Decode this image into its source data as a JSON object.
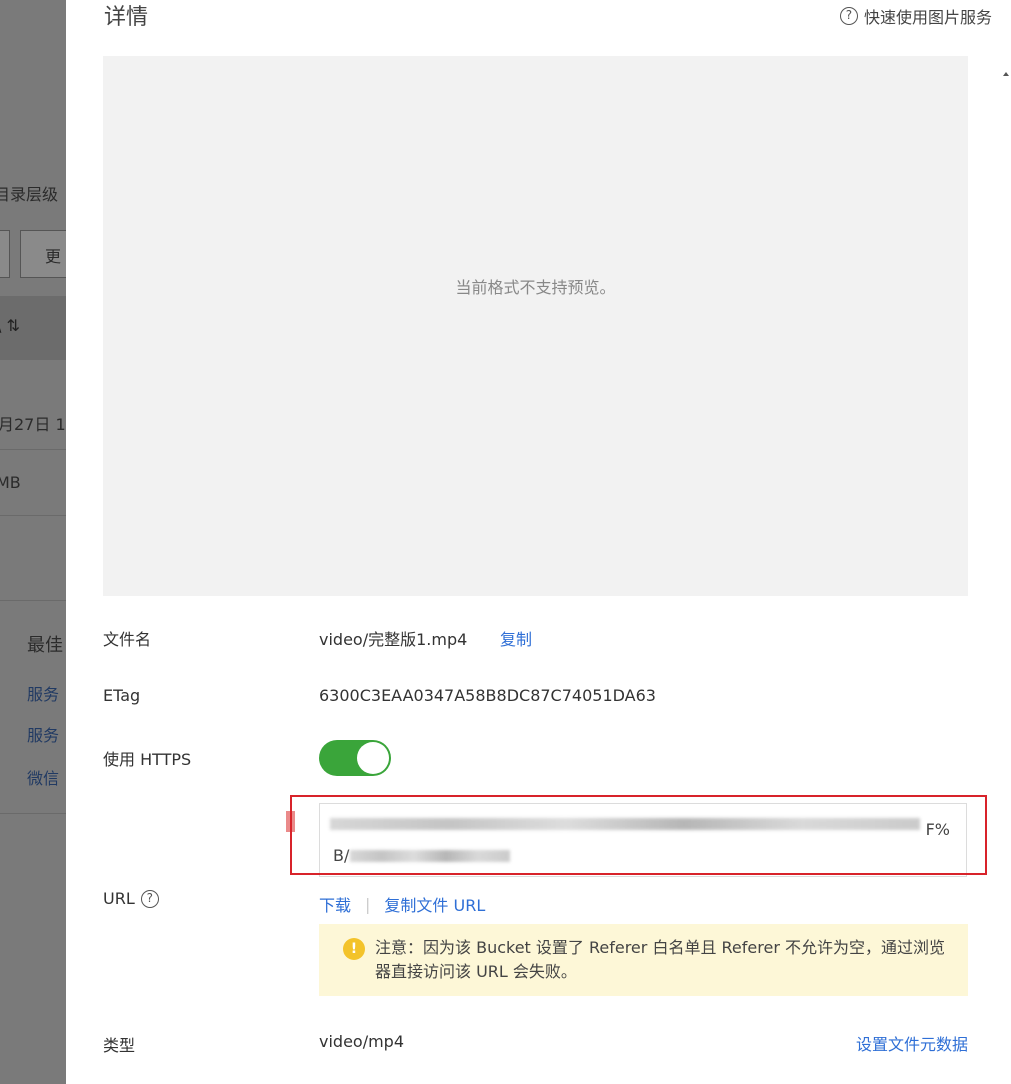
{
  "background_page": {
    "dir_level": "目录层级",
    "more_button": "更",
    "date": "月27日 1",
    "size": "MB",
    "section_title": "最佳",
    "links": [
      "服务",
      "服务",
      "微信"
    ]
  },
  "drawer": {
    "title": "详情",
    "help_link": "快速使用图片服务",
    "preview_text": "当前格式不支持预览。",
    "fields": {
      "filename_label": "文件名",
      "filename_value": "video/完整版1.mp4",
      "copy_label": "复制",
      "etag_label": "ETag",
      "etag_value": "6300C3EAA0347A58B8DC87C74051DA63",
      "https_label": "使用 HTTPS",
      "https_enabled": true,
      "url_label": "URL",
      "url_tail": "F%",
      "url_head": "B/",
      "download_label": "下载",
      "copy_url_label": "复制文件 URL",
      "notice_text": "注意：因为该 Bucket 设置了 Referer 白名单且 Referer 不允许为空，通过浏览器直接访问该 URL 会失败。",
      "type_label": "类型",
      "type_value": "video/mp4",
      "meta_link": "设置文件元数据"
    }
  },
  "colors": {
    "accent": "#2f6fd6",
    "toggle_on": "#3aa53a",
    "highlight_frame": "#d8232a",
    "notice_bg": "#fdf7d7"
  }
}
